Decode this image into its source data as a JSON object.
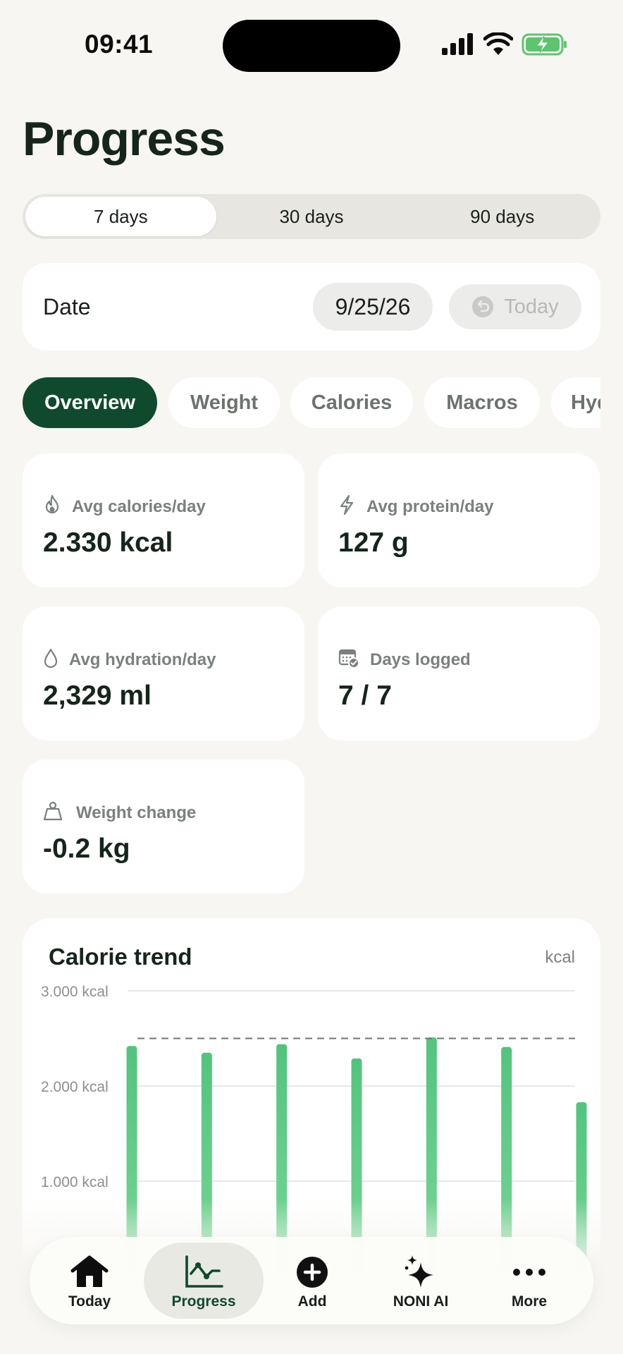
{
  "status_bar": {
    "time": "09:41"
  },
  "page": {
    "title": "Progress"
  },
  "range": {
    "options": [
      {
        "label": "7 days",
        "active": true
      },
      {
        "label": "30 days",
        "active": false
      },
      {
        "label": "90 days",
        "active": false
      }
    ]
  },
  "date_card": {
    "label": "Date",
    "value": "9/25/26",
    "today_label": "Today"
  },
  "tabs": [
    {
      "label": "Overview",
      "active": true
    },
    {
      "label": "Weight",
      "active": false
    },
    {
      "label": "Calories",
      "active": false
    },
    {
      "label": "Macros",
      "active": false
    },
    {
      "label": "Hydration",
      "active": false
    }
  ],
  "stats": {
    "calories": {
      "label": "Avg calories/day",
      "value": "2.330 kcal",
      "icon": "flame-icon"
    },
    "protein": {
      "label": "Avg protein/day",
      "value": "127 g",
      "icon": "bolt-icon"
    },
    "hydration": {
      "label": "Avg hydration/day",
      "value": "2,329 ml",
      "icon": "droplet-icon"
    },
    "days": {
      "label": "Days logged",
      "value": "7 / 7",
      "icon": "calendar-check-icon"
    },
    "weight": {
      "label": "Weight change",
      "value": "-0.2 kg",
      "icon": "weight-icon"
    }
  },
  "chart": {
    "title": "Calorie trend",
    "unit": "kcal"
  },
  "chart_data": {
    "type": "bar",
    "title": "Calorie trend",
    "ylabel": "kcal",
    "ylim": [
      0,
      3000
    ],
    "yticks": [
      {
        "value": 3000,
        "label": "3.000 kcal"
      },
      {
        "value": 2000,
        "label": "2.000 kcal"
      },
      {
        "value": 1000,
        "label": "1.000 kcal"
      }
    ],
    "values": [
      2420,
      2350,
      2440,
      2290,
      2510,
      2410,
      1830
    ],
    "target": 2500,
    "bar_color": "#52c47d",
    "grid": true
  },
  "nav": {
    "items": [
      {
        "label": "Today",
        "icon": "home-icon",
        "active": false
      },
      {
        "label": "Progress",
        "icon": "chart-line-icon",
        "active": true
      },
      {
        "label": "Add",
        "icon": "plus-circle-icon",
        "active": false
      },
      {
        "label": "NONI AI",
        "icon": "sparkles-icon",
        "active": false
      },
      {
        "label": "More",
        "icon": "more-icon",
        "active": false
      }
    ]
  },
  "colors": {
    "background": "#f7f6f2",
    "accent": "#0f4a2c",
    "bar": "#52c47d"
  }
}
